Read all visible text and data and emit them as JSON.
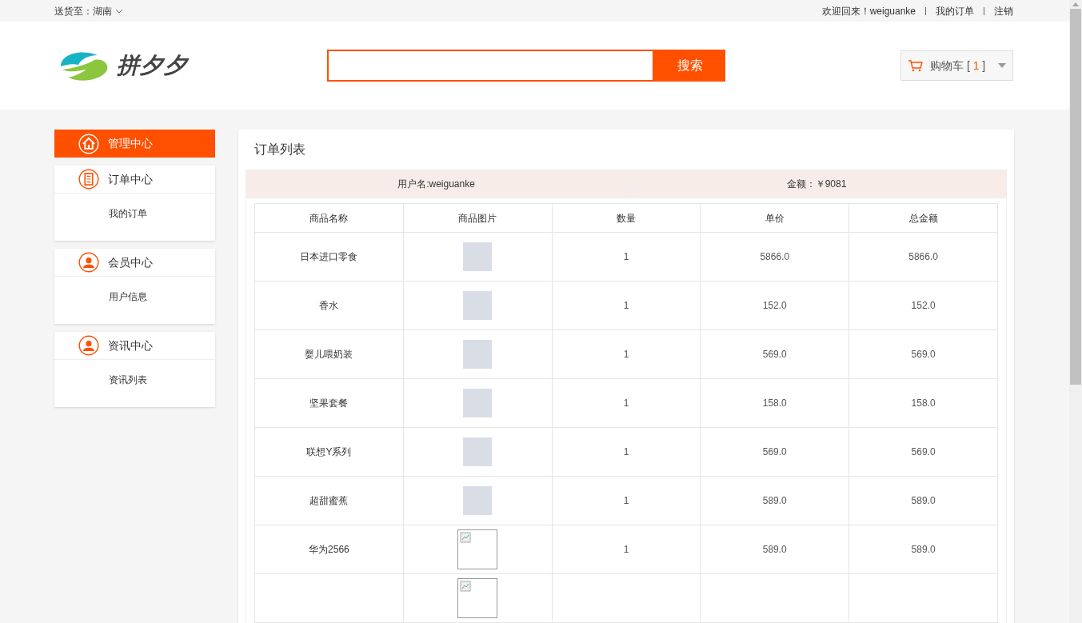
{
  "top_bar": {
    "location_label": "送货至：湖南",
    "welcome": "欢迎回来！weiguanke",
    "links": [
      "我的订单",
      "注销"
    ]
  },
  "header": {
    "logo_text": "拼夕夕",
    "search": {
      "button": "搜索"
    },
    "cart": {
      "label": "购物车",
      "open_bracket": "[",
      "count": "1",
      "close_bracket": "]"
    }
  },
  "sidebar": [
    {
      "title": "管理中心",
      "kind": "home",
      "selected": true
    },
    {
      "title": "订单中心",
      "kind": "document",
      "selected": false,
      "items": [
        "我的订单"
      ]
    },
    {
      "title": "会员中心",
      "kind": "user",
      "selected": false,
      "items": [
        "用户信息"
      ]
    },
    {
      "title": "资讯中心",
      "kind": "user",
      "selected": false,
      "items": [
        "资讯列表"
      ]
    }
  ],
  "order_panel": {
    "title": "订单列表",
    "summary": [
      "用户名:weiguanke",
      "金额：￥9081"
    ],
    "table": {
      "columns": [
        "商品名称",
        "商品图片",
        "数量",
        "单价",
        "总金额"
      ],
      "rows": [
        {
          "name": "日本进口零食",
          "kind": "photo",
          "quantity": "1",
          "unit_price": "5866.0",
          "total": "5866.0"
        },
        {
          "name": "香水",
          "kind": "photo",
          "quantity": "1",
          "unit_price": "152.0",
          "total": "152.0"
        },
        {
          "name": "婴儿喂奶装",
          "kind": "photo",
          "quantity": "1",
          "unit_price": "569.0",
          "total": "569.0"
        },
        {
          "name": "坚果套餐",
          "kind": "photo",
          "quantity": "1",
          "unit_price": "158.0",
          "total": "158.0"
        },
        {
          "name": "联想Y系列",
          "kind": "photo",
          "quantity": "1",
          "unit_price": "569.0",
          "total": "569.0"
        },
        {
          "name": "超甜蜜蕉",
          "kind": "photo",
          "quantity": "1",
          "unit_price": "589.0",
          "total": "589.0"
        },
        {
          "name": "华为2566",
          "kind": "broken",
          "quantity": "1",
          "unit_price": "589.0",
          "total": "589.0"
        },
        {
          "kind": "broken"
        }
      ]
    }
  }
}
